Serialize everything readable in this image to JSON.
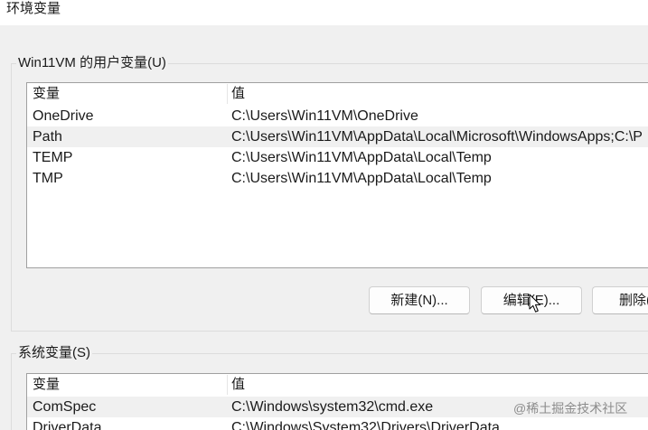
{
  "window": {
    "title": "环境变量"
  },
  "user_variables": {
    "group_label": "Win11VM 的用户变量(U)",
    "columns": {
      "name": "变量",
      "value": "值"
    },
    "rows": [
      {
        "name": "OneDrive",
        "value": "C:\\Users\\Win11VM\\OneDrive",
        "highlighted": false
      },
      {
        "name": "Path",
        "value": "C:\\Users\\Win11VM\\AppData\\Local\\Microsoft\\WindowsApps;C:\\P",
        "highlighted": true
      },
      {
        "name": "TEMP",
        "value": "C:\\Users\\Win11VM\\AppData\\Local\\Temp",
        "highlighted": false
      },
      {
        "name": "TMP",
        "value": "C:\\Users\\Win11VM\\AppData\\Local\\Temp",
        "highlighted": false
      }
    ],
    "buttons": {
      "new_label": "新建(N)...",
      "edit_label": "编辑(E)...",
      "delete_label": "删除("
    }
  },
  "system_variables": {
    "group_label": "系统变量(S)",
    "columns": {
      "name": "变量",
      "value": "值"
    },
    "rows": [
      {
        "name": "ComSpec",
        "value": "C:\\Windows\\system32\\cmd.exe",
        "highlighted": true
      },
      {
        "name": "DriverData",
        "value": "C:\\Windows\\System32\\Drivers\\DriverData",
        "highlighted": false
      }
    ]
  },
  "watermark": "@稀土掘金技术社区",
  "cursor": {
    "icon": "mouse-pointer-icon"
  },
  "colors": {
    "dialog_background": "#f0f0f0",
    "title_bar_background": "#ffffff",
    "list_background": "#ffffff",
    "highlighted_row": "#f0f0f0",
    "text": "#1a1a1a",
    "watermark": "#8c8c8c"
  }
}
